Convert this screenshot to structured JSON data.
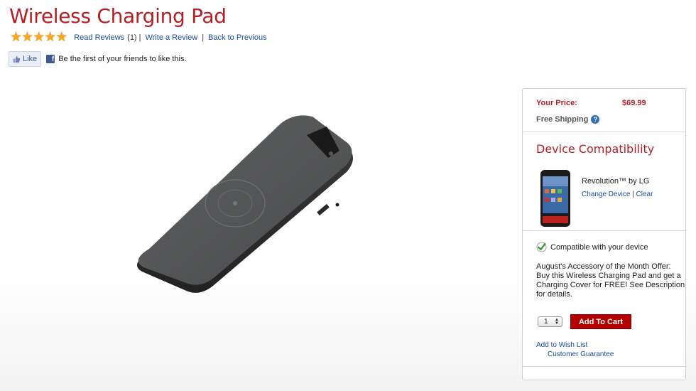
{
  "product": {
    "title": "Wireless Charging Pad",
    "rating_stars": 5,
    "read_reviews": "Read Reviews",
    "review_count": "(1)",
    "write_review": "Write a Review",
    "back_to_previous": "Back to Previous",
    "separator": "|"
  },
  "social": {
    "like_label": "Like",
    "fb_letter": "f",
    "friends_text": "Be the first of your friends to like this."
  },
  "purchase": {
    "price_label": "Your Price:",
    "price_value": "$69.99",
    "shipping": "Free Shipping",
    "help_glyph": "?",
    "compat_title": "Device Compatibility",
    "device_name": "Revolution™ by LG",
    "change_device": "Change Device",
    "link_sep": "|",
    "clear": "Clear",
    "compat_status": "Compatible with your device",
    "offer_text": "August's Accessory of the Month Offer: Buy this Wireless Charging Pad and get a Charging Cover for FREE! See Description for details.",
    "quantity": "1",
    "add_to_cart": "Add To Cart",
    "wish_list": "Add to Wish List",
    "guarantee": "Customer Guarantee"
  },
  "colors": {
    "brand_red": "#b51f24",
    "link_blue": "#1a4b9c",
    "star_gold": "#f5a623"
  }
}
